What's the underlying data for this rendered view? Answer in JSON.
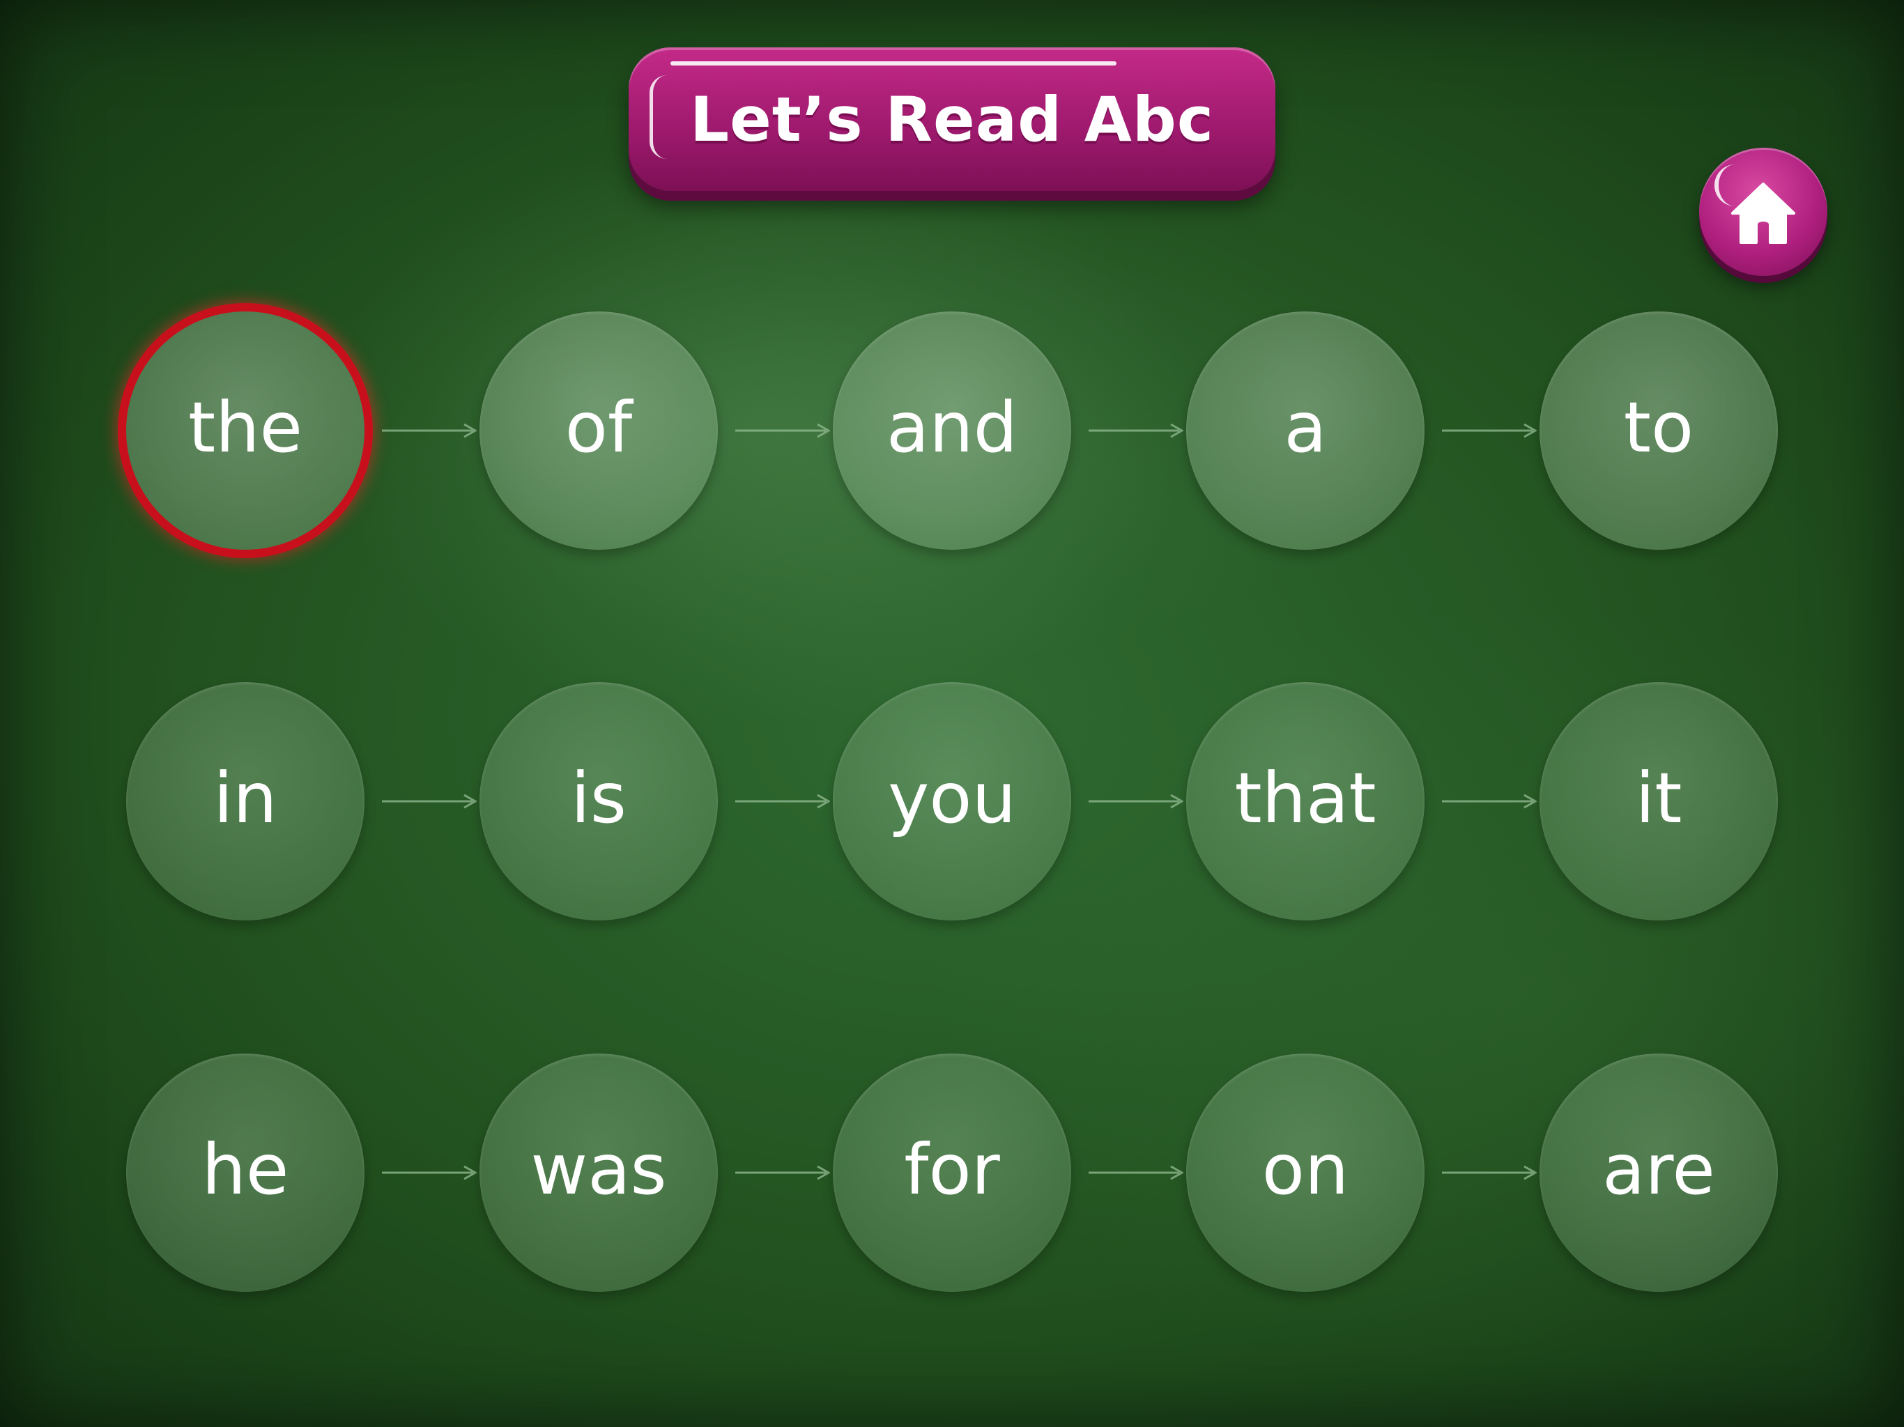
{
  "app": {
    "title": "Let’s Read Abc"
  },
  "home_button": {
    "icon": "home-icon",
    "color": "#b0207f"
  },
  "colors": {
    "banner": "#a01a6f",
    "selected_ring": "#c8101c",
    "board": "#22521f"
  },
  "words": {
    "rows": [
      [
        "the",
        "of",
        "and",
        "a",
        "to"
      ],
      [
        "in",
        "is",
        "you",
        "that",
        "it"
      ],
      [
        "he",
        "was",
        "for",
        "on",
        "are"
      ]
    ],
    "selected": "the"
  }
}
